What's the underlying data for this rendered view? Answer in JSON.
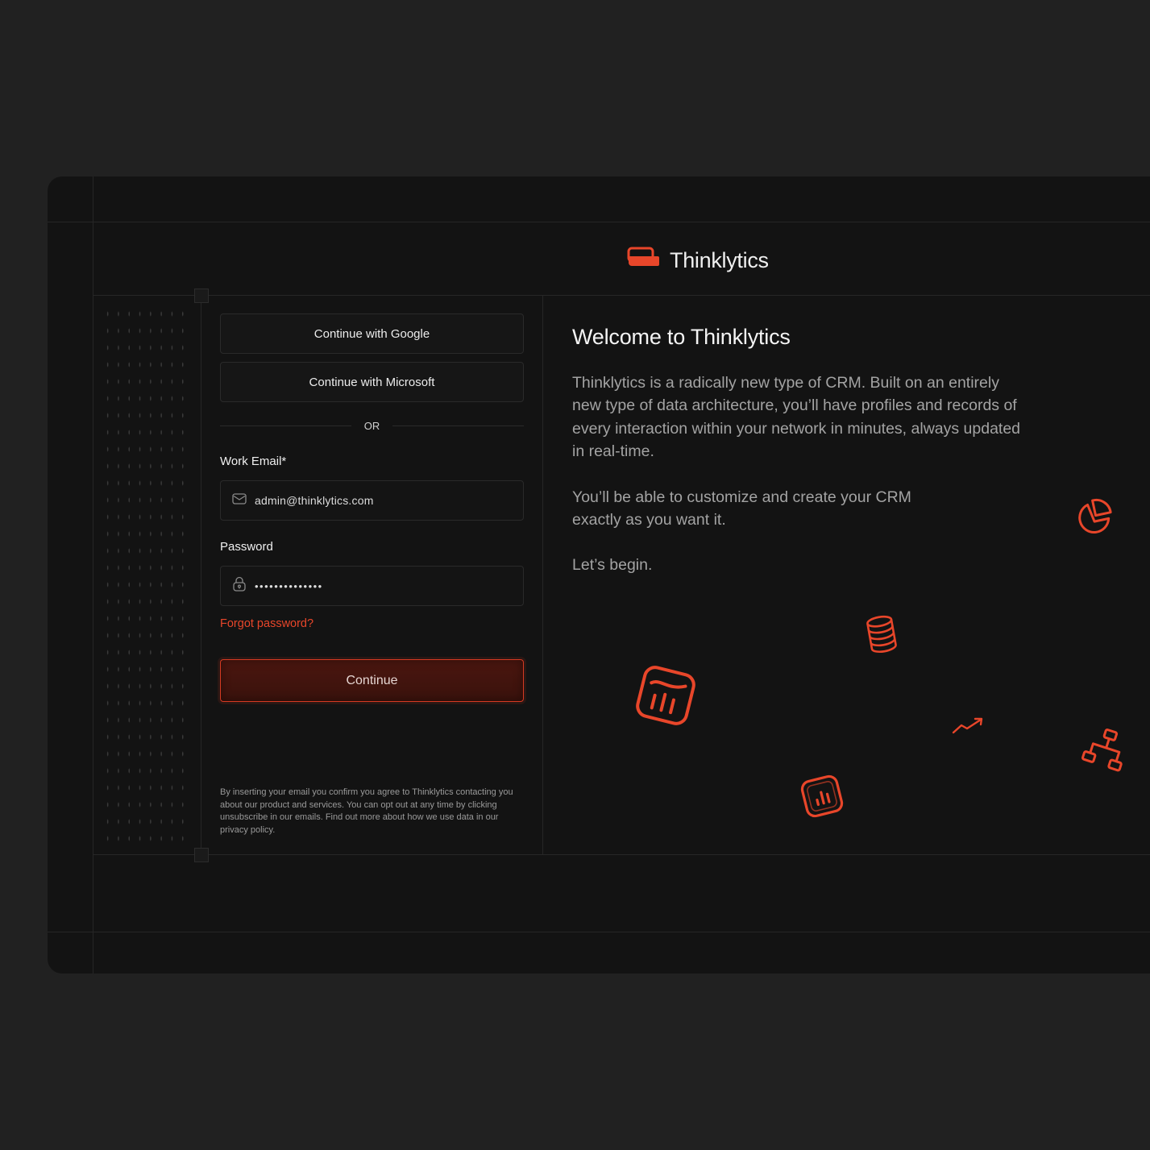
{
  "brand": {
    "name": "Thinklytics",
    "accent": "#e8462a"
  },
  "auth": {
    "google_label": "Continue with Google",
    "microsoft_label": "Continue with Microsoft",
    "divider_label": "OR",
    "email_label": "Work Email*",
    "email_value": "admin@thinklytics.com",
    "password_label": "Password",
    "password_value": "••••••••••••••",
    "forgot_label": "Forgot password?",
    "continue_label": "Continue",
    "legal_text": "By inserting your email you confirm you agree to Thinklytics contacting you about our product and services. You can opt out at any time by clicking unsubscribe in our emails. Find out more about how we use data in our privacy policy."
  },
  "intro": {
    "heading": "Welcome to Thinklytics",
    "paragraph_1": "Thinklytics is a radically new type of CRM. Built on an entirely new type of data architecture, you’ll have profiles and records of every interaction within your network in minutes, always updated in real-time.",
    "paragraph_2": "You’ll be able to customize and create your CRM exactly as you want it.",
    "paragraph_3": "Let’s begin."
  },
  "icons": {
    "logo": "stacked-cards-logo-icon",
    "email": "mail-icon",
    "password": "lock-icon",
    "decorations": [
      "pie-chart-icon",
      "database-icon",
      "bar-chart-icon",
      "trend-up-icon",
      "network-icon",
      "bar-chart-square-icon"
    ]
  }
}
